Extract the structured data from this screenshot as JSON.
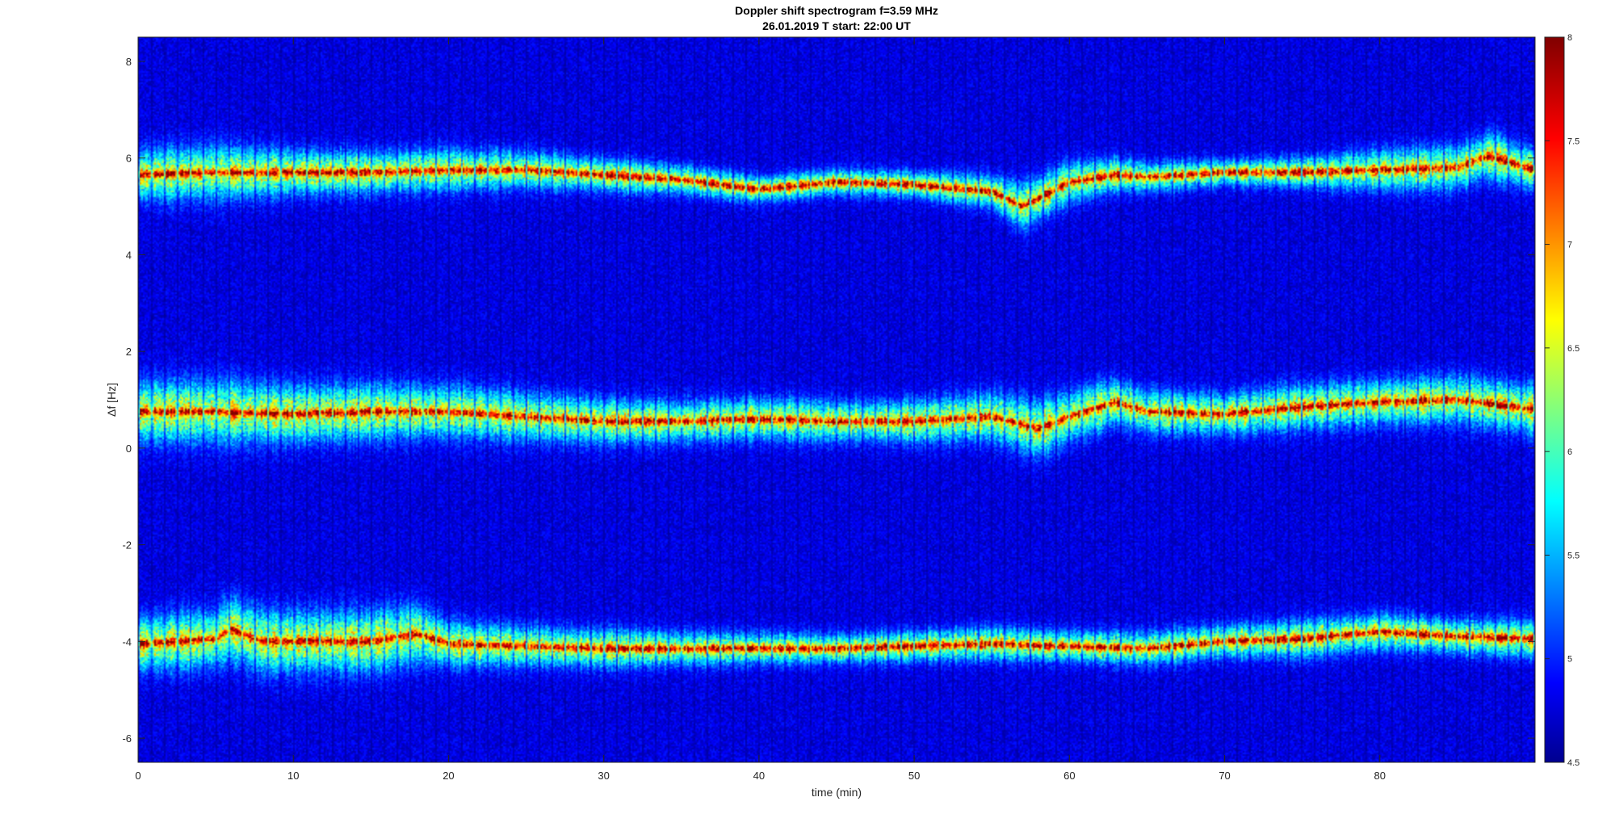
{
  "chart_data": {
    "type": "heatmap",
    "title": "Doppler shift spectrogram f=3.59 MHz",
    "subtitle": "26.01.2019    T start: 22:00 UT",
    "xlabel": "time (min)",
    "ylabel": "Δf [Hz]",
    "xlim": [
      0,
      90
    ],
    "ylim": [
      -6.5,
      8.5
    ],
    "x_ticks": [
      "0",
      "10",
      "20",
      "30",
      "40",
      "50",
      "60",
      "70",
      "80"
    ],
    "x_tick_values": [
      0,
      10,
      20,
      30,
      40,
      50,
      60,
      70,
      80
    ],
    "y_ticks": [
      "8",
      "6",
      "4",
      "2",
      "0",
      "-2",
      "-4",
      "-6"
    ],
    "y_tick_values": [
      8,
      6,
      4,
      2,
      0,
      -2,
      -4,
      -6
    ],
    "colorbar": {
      "range": [
        4.5,
        8
      ],
      "ticks": [
        "8",
        "7.5",
        "7",
        "6.5",
        "6",
        "5.5",
        "5",
        "4.5"
      ],
      "tick_values": [
        8,
        7.5,
        7,
        6.5,
        6,
        5.5,
        5,
        4.5
      ],
      "colormap": "jet"
    },
    "series": [
      {
        "band": "upper",
        "t": [
          0,
          5,
          10,
          15,
          20,
          25,
          30,
          35,
          40,
          45,
          50,
          55,
          57,
          60,
          63,
          65,
          70,
          75,
          80,
          85,
          87,
          90
        ],
        "peak": [
          5.65,
          5.7,
          5.7,
          5.7,
          5.75,
          5.75,
          5.65,
          5.55,
          5.35,
          5.5,
          5.45,
          5.3,
          5.0,
          5.5,
          5.65,
          5.6,
          5.7,
          5.7,
          5.75,
          5.8,
          6.05,
          5.75
        ],
        "width": [
          0.65,
          0.75,
          0.6,
          0.55,
          0.55,
          0.5,
          0.45,
          0.4,
          0.35,
          0.35,
          0.35,
          0.45,
          0.6,
          0.55,
          0.45,
          0.4,
          0.35,
          0.4,
          0.55,
          0.6,
          0.6,
          0.55
        ]
      },
      {
        "band": "middle",
        "t": [
          0,
          5,
          10,
          15,
          20,
          25,
          30,
          35,
          40,
          45,
          50,
          55,
          58,
          60,
          63,
          65,
          70,
          75,
          80,
          85,
          90
        ],
        "peak": [
          0.75,
          0.75,
          0.7,
          0.75,
          0.75,
          0.65,
          0.55,
          0.55,
          0.6,
          0.55,
          0.55,
          0.65,
          0.4,
          0.65,
          0.95,
          0.75,
          0.7,
          0.85,
          0.95,
          1.0,
          0.8
        ],
        "width": [
          0.8,
          0.85,
          0.75,
          0.75,
          0.7,
          0.65,
          0.6,
          0.55,
          0.55,
          0.55,
          0.55,
          0.65,
          0.75,
          0.7,
          0.6,
          0.6,
          0.55,
          0.6,
          0.6,
          0.65,
          0.65
        ]
      },
      {
        "band": "lower",
        "t": [
          0,
          5,
          6,
          8,
          10,
          15,
          18,
          20,
          25,
          30,
          35,
          40,
          45,
          50,
          55,
          60,
          65,
          70,
          75,
          80,
          85,
          90
        ],
        "peak": [
          -4.05,
          -3.95,
          -3.75,
          -4.0,
          -4.0,
          -4.0,
          -3.85,
          -4.05,
          -4.1,
          -4.15,
          -4.15,
          -4.15,
          -4.15,
          -4.1,
          -4.05,
          -4.1,
          -4.15,
          -4.0,
          -3.95,
          -3.8,
          -3.9,
          -3.95
        ],
        "width": [
          0.7,
          0.8,
          0.85,
          0.85,
          0.85,
          0.8,
          0.8,
          0.6,
          0.55,
          0.5,
          0.45,
          0.4,
          0.4,
          0.4,
          0.45,
          0.4,
          0.45,
          0.45,
          0.5,
          0.5,
          0.45,
          0.5
        ]
      }
    ]
  }
}
